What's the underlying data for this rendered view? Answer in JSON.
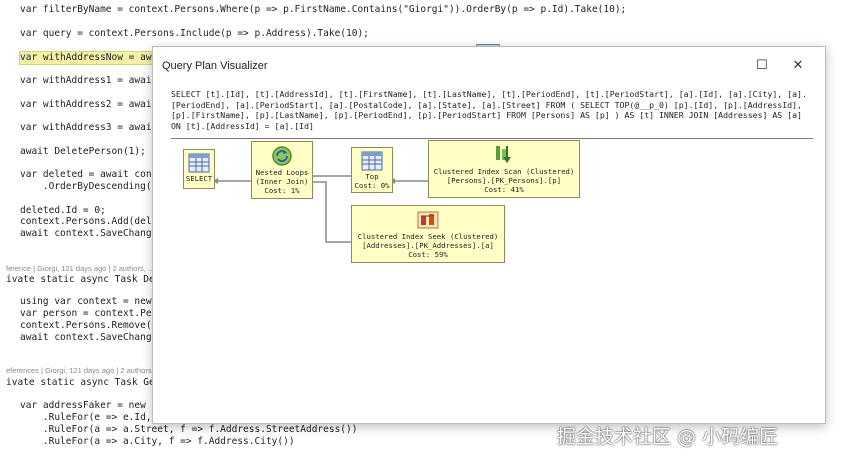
{
  "editor": {
    "lines": [
      "var filterByName = context.Persons.Where(p => p.FirstName.Contains(\"Giorgi\")).OrderBy(p => p.Id).Take(10);",
      "var query = context.Persons.Include(p => p.Address).Take(10);",
      "var withAddressNow = awai",
      "var withAddress1 = await",
      "var withAddress2 = await",
      "var withAddress3 = await",
      "await DeletePerson(1);",
      "var deleted = await conte",
      "    .OrderByDescending(cu",
      "deleted.Id = 0;",
      "context.Persons.Add(delet",
      "await context.SaveChanges",
      "ivate static async Task Del",
      "using var context = new T",
      "var person = context.Perso",
      "context.Persons.Remove(pe",
      "await context.SaveChanges",
      "ivate static async Task Gen",
      "var addressFaker = new Fa",
      "    .RuleFor(e => e.Id, f",
      "    .RuleFor(a => a.Street, f => f.Address.StreetAddress())",
      "    .RuleFor(a => a.City, f => f.Address.City())"
    ],
    "codelens": [
      "ference | Giorgi, 121 days ago | 2 authors, ...",
      "eferences | Giorgi, 121 days ago | 2 authors, ..."
    ]
  },
  "dialog": {
    "title": "Query Plan Visualizer",
    "minimize_icon": "☐",
    "close_icon": "✕",
    "sql": "SELECT [t].[Id], [t].[AddressId], [t].[FirstName], [t].[LastName], [t].[PeriodEnd], [t].[PeriodStart], [a].[Id], [a].[City], [a].[PeriodEnd], [a].[PeriodStart], [a].[PostalCode], [a].[State], [a].[Street] FROM ( SELECT TOP(@__p_0) [p].[Id], [p].[AddressId], [p].[FirstName], [p].[LastName], [p].[PeriodEnd], [p].[PeriodStart] FROM [Persons] AS [p] ) AS [t] INNER JOIN [Addresses] AS [a] ON [t].[AddressId] = [a].[Id]"
  },
  "plan": {
    "select": {
      "label": "SELECT"
    },
    "nested_loops": {
      "line1": "Nested Loops",
      "line2": "(Inner Join)",
      "cost": "Cost: 1%"
    },
    "top": {
      "line1": "Top",
      "cost": "Cost: 0%"
    },
    "index_scan": {
      "line1": "Clustered Index Scan (Clustered)",
      "line2": "[Persons].[PK_Persons].[p]",
      "cost": "Cost: 41%"
    },
    "index_seek": {
      "line1": "Clustered Index Seek (Clustered)",
      "line2": "[Addresses].[PK_Addresses].[a]",
      "cost": "Cost: 59%"
    }
  },
  "watermark": "掘金技术社区 @ 小码编匠",
  "colors": {
    "node_fill": "#ffffc6",
    "highlight": "#f3f0a8",
    "keyword": "#1a3fb0"
  }
}
